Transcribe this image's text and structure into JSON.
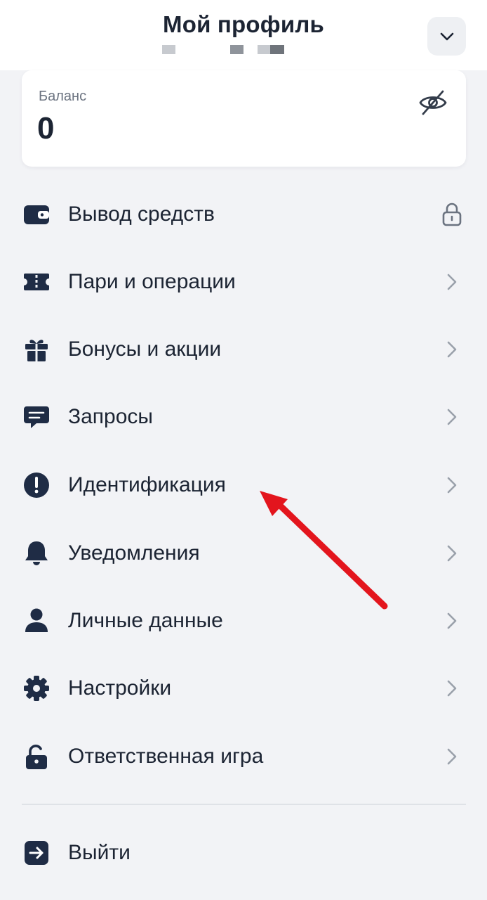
{
  "header": {
    "title": "Мой профиль",
    "chevron_icon": "chevron-down-icon"
  },
  "balance": {
    "label": "Баланс",
    "value": "0",
    "toggle_icon": "eye-off-icon"
  },
  "menu": {
    "items": [
      {
        "label": "Вывод средств",
        "icon": "wallet-icon",
        "trail": "lock-icon"
      },
      {
        "label": "Пари и операции",
        "icon": "ticket-icon",
        "trail": "chevron-right-icon"
      },
      {
        "label": "Бонусы и акции",
        "icon": "gift-icon",
        "trail": "chevron-right-icon"
      },
      {
        "label": "Запросы",
        "icon": "chat-icon",
        "trail": "chevron-right-icon"
      },
      {
        "label": "Идентификация",
        "icon": "alert-circle-icon",
        "trail": "chevron-right-icon"
      },
      {
        "label": "Уведомления",
        "icon": "bell-icon",
        "trail": "chevron-right-icon"
      },
      {
        "label": "Личные данные",
        "icon": "person-icon",
        "trail": "chevron-right-icon"
      },
      {
        "label": "Настройки",
        "icon": "gear-icon",
        "trail": "chevron-right-icon"
      },
      {
        "label": "Ответственная игра",
        "icon": "unlock-icon",
        "trail": "chevron-right-icon"
      }
    ],
    "logout": {
      "label": "Выйти",
      "icon": "logout-icon"
    }
  },
  "colors": {
    "icon": "#1f2c45",
    "chevron": "#9aa1ab",
    "background": "#f2f3f6",
    "annotation_arrow": "#e3151d"
  }
}
